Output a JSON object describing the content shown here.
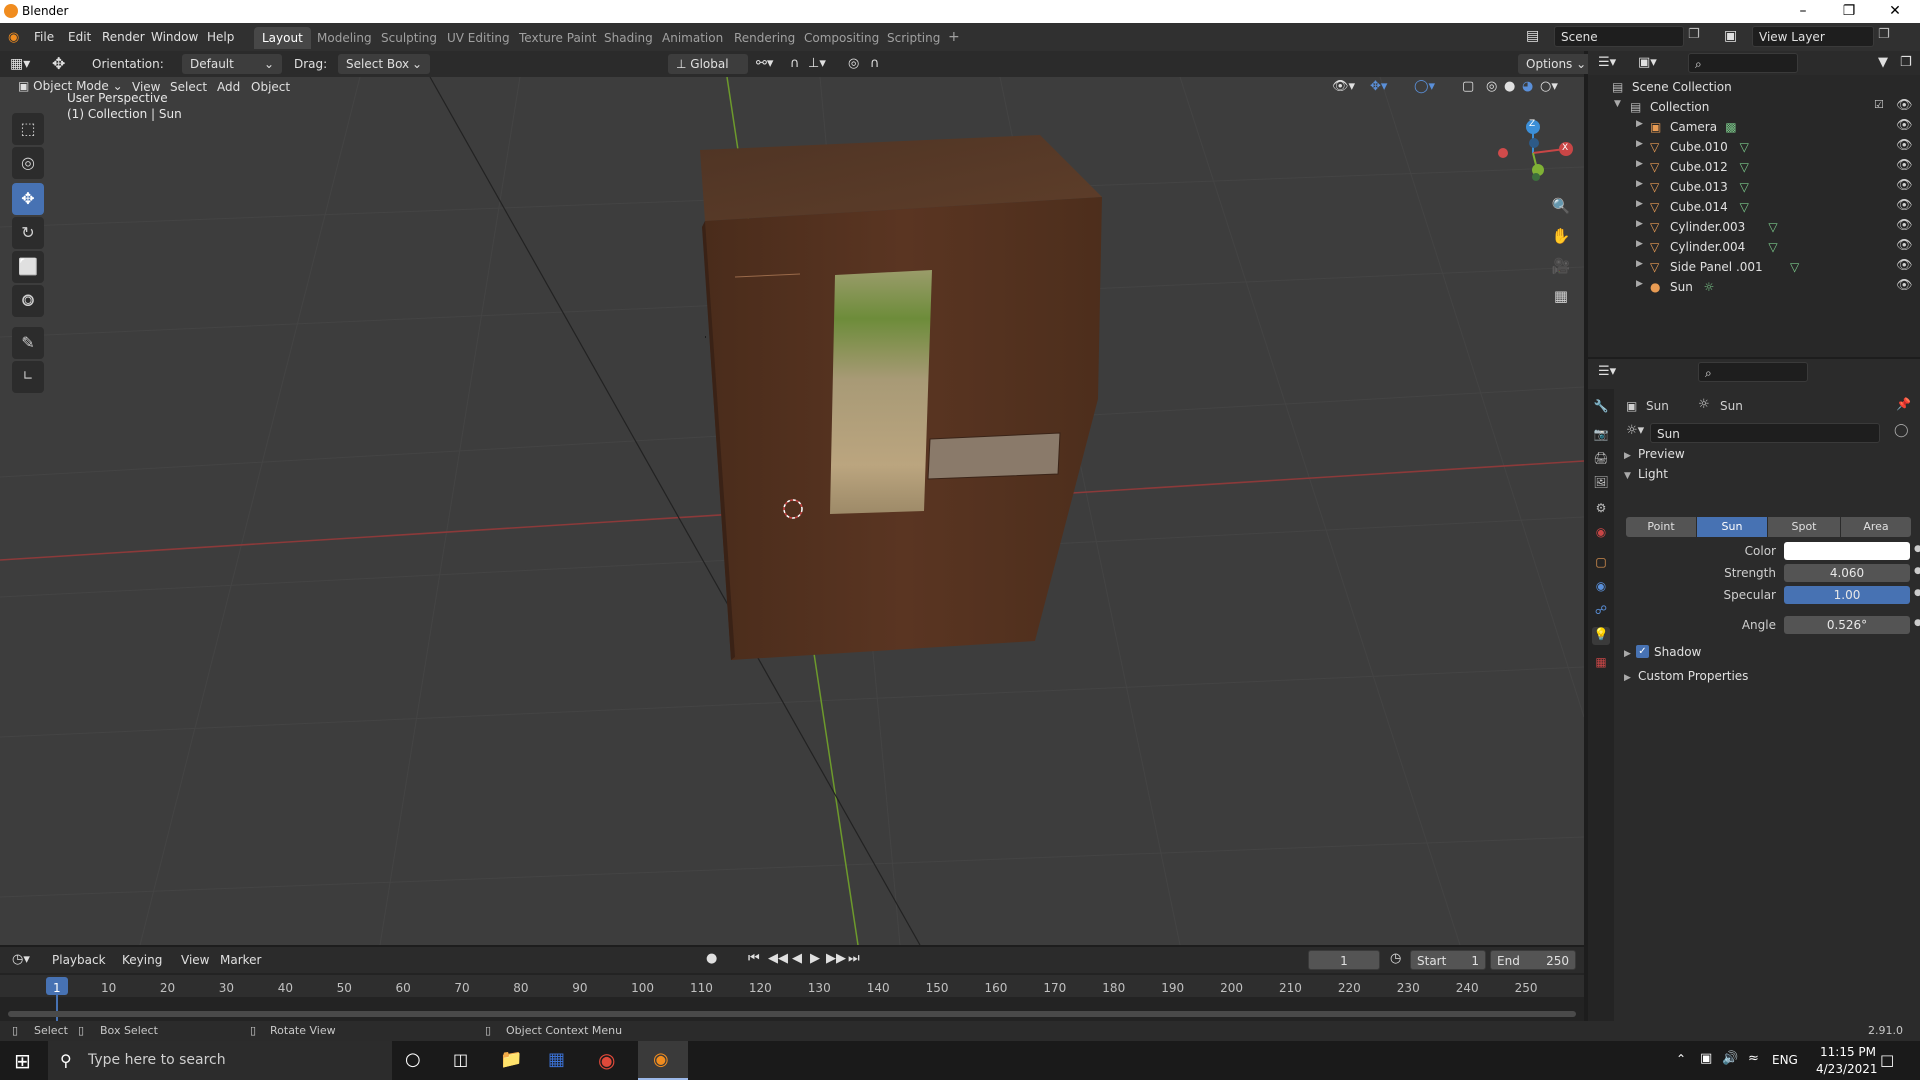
{
  "window": {
    "title": "Blender",
    "minimize": "–",
    "restore": "❐",
    "close": "✕"
  },
  "menu": [
    "File",
    "Edit",
    "Render",
    "Window",
    "Help"
  ],
  "workspaces": [
    {
      "label": "Layout",
      "active": true
    },
    {
      "label": "Modeling"
    },
    {
      "label": "Sculpting"
    },
    {
      "label": "UV Editing"
    },
    {
      "label": "Texture Paint"
    },
    {
      "label": "Shading"
    },
    {
      "label": "Animation"
    },
    {
      "label": "Rendering"
    },
    {
      "label": "Compositing"
    },
    {
      "label": "Scripting"
    }
  ],
  "add_workspace": "+",
  "scene": {
    "label": "Scene",
    "view_layer": "View Layer"
  },
  "tool_header": {
    "orientation_label": "Orientation:",
    "orientation_value": "Default",
    "drag_label": "Drag:",
    "drag_value": "Select Box",
    "transform_orientation": "Global",
    "options": "Options"
  },
  "viewport_header": {
    "mode": "Object Mode",
    "menus": [
      "View",
      "Select",
      "Add",
      "Object"
    ]
  },
  "viewport": {
    "perspective": "User Perspective",
    "collection_info": "(1) Collection | Sun",
    "gizmo_axes": {
      "z": "Z",
      "x": "X",
      "y": "Y"
    }
  },
  "tools": [
    {
      "name": "select-box-tool",
      "glyph": "⬚"
    },
    {
      "name": "cursor-tool",
      "glyph": "◎"
    },
    {
      "name": "move-tool",
      "glyph": "✥",
      "active": true
    },
    {
      "name": "rotate-tool",
      "glyph": "↻"
    },
    {
      "name": "scale-tool",
      "glyph": "⬜"
    },
    {
      "name": "transform-tool",
      "glyph": "⭗"
    },
    {
      "name": "annotate-tool",
      "glyph": "✎"
    },
    {
      "name": "measure-tool",
      "glyph": "📐"
    }
  ],
  "outliner": {
    "root": "Scene Collection",
    "collection": "Collection",
    "items": [
      {
        "name": "Camera",
        "type": "camera"
      },
      {
        "name": "Cube.010",
        "type": "mesh"
      },
      {
        "name": "Cube.012",
        "type": "mesh"
      },
      {
        "name": "Cube.013",
        "type": "mesh"
      },
      {
        "name": "Cube.014",
        "type": "mesh"
      },
      {
        "name": "Cylinder.003",
        "type": "mesh"
      },
      {
        "name": "Cylinder.004",
        "type": "mesh"
      },
      {
        "name": "Side Panel .001",
        "type": "mesh"
      },
      {
        "name": "Sun",
        "type": "light"
      }
    ]
  },
  "properties": {
    "breadcrumb_object": "Sun",
    "breadcrumb_data": "Sun",
    "datablock_name": "Sun",
    "panels": {
      "preview": "Preview",
      "light": "Light",
      "shadow": "Shadow",
      "custom": "Custom Properties"
    },
    "light_types": [
      {
        "label": "Point"
      },
      {
        "label": "Sun",
        "selected": true
      },
      {
        "label": "Spot"
      },
      {
        "label": "Area"
      }
    ],
    "color_label": "Color",
    "color_value": "#ffffff",
    "strength_label": "Strength",
    "strength_value": "4.060",
    "specular_label": "Specular",
    "specular_value": "1.00",
    "angle_label": "Angle",
    "angle_value": "0.526°",
    "shadow_checked": true
  },
  "timeline": {
    "menus": [
      "Playback",
      "Keying",
      "View",
      "Marker"
    ],
    "current_frame": "1",
    "start_label": "Start",
    "start_value": "1",
    "end_label": "End",
    "end_value": "250",
    "ticks": [
      "1",
      "10",
      "20",
      "30",
      "40",
      "50",
      "60",
      "70",
      "80",
      "90",
      "100",
      "110",
      "120",
      "130",
      "140",
      "150",
      "160",
      "170",
      "180",
      "190",
      "200",
      "210",
      "220",
      "230",
      "240",
      "250"
    ]
  },
  "statusbar": {
    "select": "Select",
    "box_select": "Box Select",
    "rotate_view": "Rotate View",
    "context_menu": "Object Context Menu",
    "version": "2.91.0"
  },
  "taskbar": {
    "search_placeholder": "Type here to search",
    "language": "ENG",
    "time": "11:15 PM",
    "date": "4/23/2021"
  },
  "colors": {
    "accent": "#4772b3",
    "brand": "#f08c1f",
    "x_axis": "#c84646",
    "y_axis": "#7fb135",
    "z_axis": "#3c8fd8"
  }
}
